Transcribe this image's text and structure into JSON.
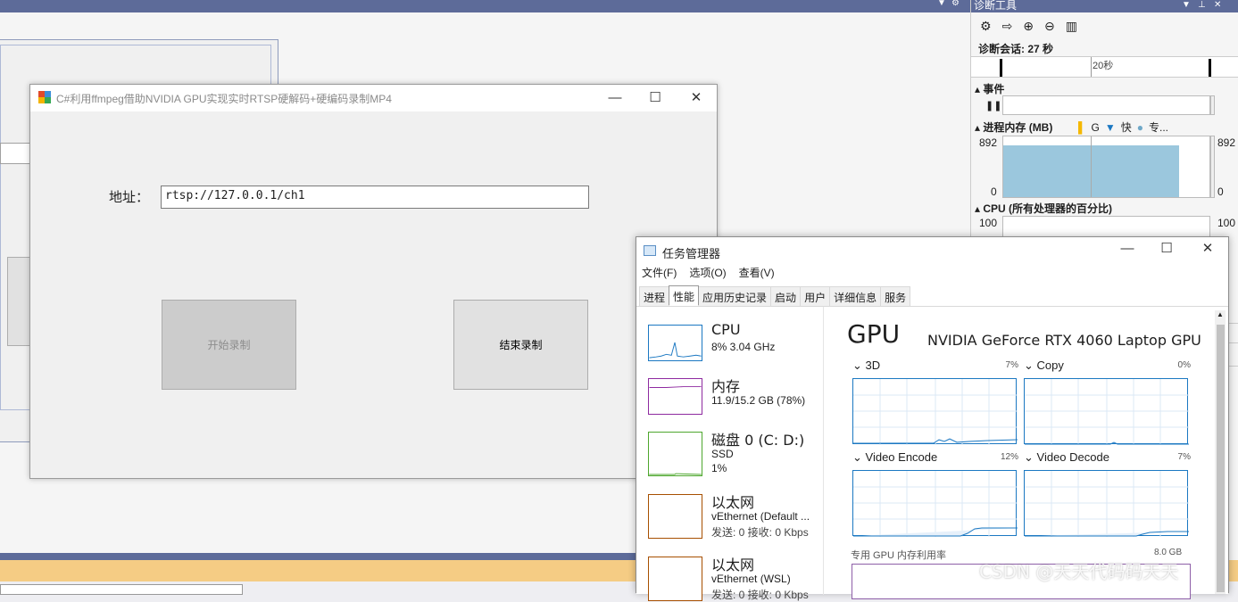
{
  "app": {
    "title": "C#利用ffmpeg借助NVIDIA GPU实现实时RTSP硬解码+硬编码录制MP4",
    "address_label": "地址：",
    "address_value": "rtsp://127.0.0.1/ch1",
    "start_button": "开始录制",
    "stop_button": "结束录制",
    "minimize": "—",
    "maximize": "☐",
    "close": "✕"
  },
  "designer_form": {
    "minimize": "▭",
    "maximize": "▣",
    "close": "⊠"
  },
  "diagnostics": {
    "title": "诊断工具",
    "session": "诊断会话: 27 秒",
    "timeline_label": "20秒",
    "events_label": "事件",
    "memory_label": "进程内存 (MB)",
    "memory_legend": [
      "G",
      "快",
      "专..."
    ],
    "memory_max": "892",
    "memory_min": "0",
    "memory_fill_fraction": 0.85,
    "cpu_label": "CPU (所有处理器的百分比)",
    "cpu_max": "100",
    "colors": {
      "gc": "#f5b800",
      "snapshot": "#1b78c2",
      "private": "#6fa8c8"
    }
  },
  "taskmgr": {
    "title": "任务管理器",
    "menu": [
      "文件(F)",
      "选项(O)",
      "查看(V)"
    ],
    "tabs": [
      "进程",
      "性能",
      "应用历史记录",
      "启动",
      "用户",
      "详细信息",
      "服务"
    ],
    "active_tab": "性能",
    "sidebar": [
      {
        "name": "CPU",
        "sub1": "8% 3.04 GHz",
        "sub2": "",
        "color": "#1b78c2"
      },
      {
        "name": "内存",
        "sub1": "11.9/15.2 GB (78%)",
        "sub2": "",
        "color": "#8e2aa0"
      },
      {
        "name": "磁盘 0 (C: D:)",
        "sub1": "SSD",
        "sub2": "1%",
        "color": "#4ea72e"
      },
      {
        "name": "以太网",
        "sub1": "vEthernet (Default ...",
        "sub2": "发送: 0 接收: 0 Kbps",
        "color": "#a74f00"
      },
      {
        "name": "以太网",
        "sub1": "vEthernet (WSL)",
        "sub2": "发送: 0 接收: 0 Kbps",
        "color": "#a74f00"
      }
    ],
    "gpu": {
      "title": "GPU",
      "name": "NVIDIA GeForce RTX 4060 Laptop GPU",
      "engines": [
        {
          "label": "3D",
          "pct": "7%"
        },
        {
          "label": "Copy",
          "pct": "0%"
        },
        {
          "label": "Video Encode",
          "pct": "12%"
        },
        {
          "label": "Video Decode",
          "pct": "7%"
        }
      ],
      "dedicated_label": "专用 GPU 内存利用率",
      "dedicated_value": "8.0 GB"
    }
  },
  "watermark": "CSDN @天天代码码天天"
}
